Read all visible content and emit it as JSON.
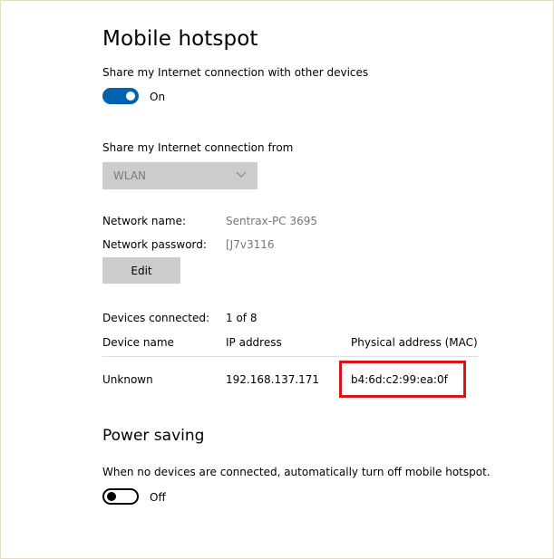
{
  "page": {
    "title": "Mobile hotspot",
    "share_label": "Share my Internet connection with other devices",
    "share_toggle": {
      "state": "On",
      "is_on": true
    },
    "share_from_label": "Share my Internet connection from",
    "share_from_select": {
      "value": "WLAN"
    },
    "network": {
      "name_label": "Network name:",
      "name_value": "Sentrax-PC 3695",
      "password_label": "Network password:",
      "password_value": "[J7v3116",
      "edit_label": "Edit"
    },
    "devices": {
      "connected_label": "Devices connected:",
      "connected_value": "1 of 8",
      "columns": [
        "Device name",
        "IP address",
        "Physical address (MAC)"
      ],
      "rows": [
        {
          "name": "Unknown",
          "ip": "192.168.137.171",
          "mac": "b4:6d:c2:99:ea:0f"
        }
      ]
    },
    "power_saving": {
      "title": "Power saving",
      "description": "When no devices are connected, automatically turn off mobile hotspot.",
      "toggle": {
        "state": "Off",
        "is_on": false
      }
    }
  },
  "colors": {
    "accent": "#0063b1",
    "highlight": "#d9141a",
    "disabled_bg": "#cccccc",
    "muted_text": "#767676"
  }
}
